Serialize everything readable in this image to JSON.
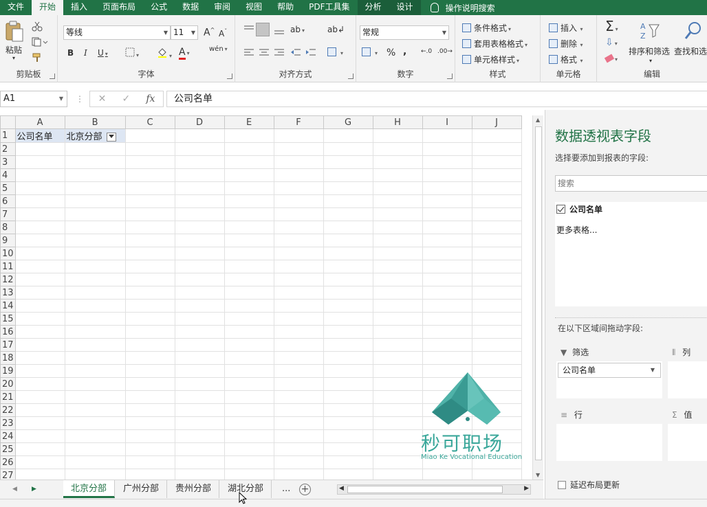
{
  "ribbon_tabs": {
    "file": "文件",
    "home": "开始",
    "insert": "插入",
    "layout": "页面布局",
    "formulas": "公式",
    "data": "数据",
    "review": "审阅",
    "view": "视图",
    "help": "帮助",
    "pdf": "PDF工具集",
    "analyze": "分析",
    "design": "设计",
    "tellme": "操作说明搜索"
  },
  "clipboard": {
    "paste": "粘贴",
    "label": "剪贴板"
  },
  "font": {
    "name": "等线",
    "size": "11",
    "bold": "B",
    "italic": "I",
    "underline": "U",
    "grow": "A",
    "shrink": "A",
    "color_letter": "A",
    "phonetic": "wén",
    "label": "字体"
  },
  "alignment": {
    "label": "对齐方式"
  },
  "number": {
    "format": "常规",
    "percent": "%",
    "comma": ",",
    "label": "数字"
  },
  "styles": {
    "conditional": "条件格式",
    "table": "套用表格格式",
    "cell": "单元格样式",
    "label": "样式"
  },
  "cells": {
    "insert": "插入",
    "delete": "删除",
    "format": "格式",
    "label": "单元格"
  },
  "editing": {
    "sigma": "Σ",
    "sort": "排序和筛选",
    "find": "查找和选择",
    "label": "编辑"
  },
  "formula_bar": {
    "cell_ref": "A1",
    "fx": "fx",
    "value": "公司名单"
  },
  "sheet": {
    "columns": [
      "A",
      "B",
      "C",
      "D",
      "E",
      "F",
      "G",
      "H",
      "I",
      "J"
    ],
    "rows": [
      "1",
      "2",
      "3",
      "4",
      "5",
      "6",
      "7",
      "8",
      "9",
      "10",
      "11",
      "12",
      "13",
      "14",
      "15",
      "16",
      "17",
      "18",
      "19",
      "20",
      "21",
      "22",
      "23",
      "24",
      "25",
      "26",
      "27"
    ],
    "a1": "公司名单",
    "b1": "北京分部"
  },
  "sheet_tabs": {
    "t1": "北京分部",
    "t2": "广州分部",
    "t3": "贵州分部",
    "t4": "湖北分部",
    "more": "...",
    "add": "+"
  },
  "pivot": {
    "title": "数据透视表字段",
    "subtitle": "选择要添加到报表的字段:",
    "search_placeholder": "搜索",
    "field1": "公司名单",
    "more_tables": "更多表格...",
    "drag_hint": "在以下区域间拖动字段:",
    "filters": "筛选",
    "columns": "列",
    "rows": "行",
    "values": "值",
    "filter_field": "公司名单",
    "defer": "延迟布局更新"
  },
  "watermark": {
    "cn": "秒可职场",
    "en": "Miao Ke Vocational Education"
  },
  "colors": {
    "accent": "#217346",
    "watermark": "#3aa79a"
  }
}
